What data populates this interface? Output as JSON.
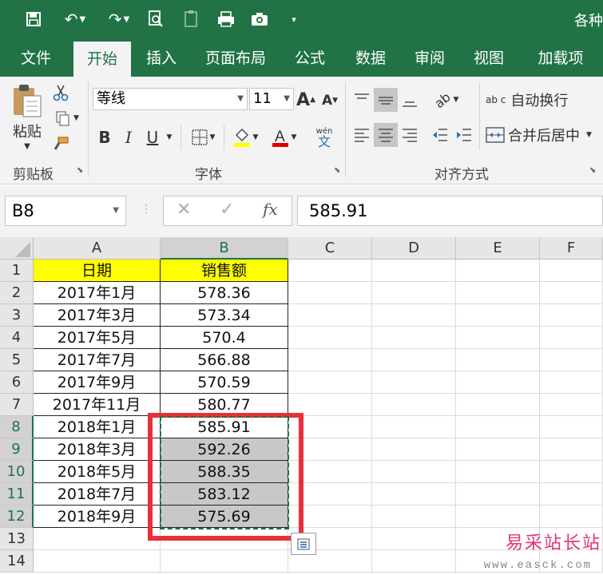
{
  "window": {
    "title_partial": "各种"
  },
  "tabs": [
    {
      "label": "文件",
      "active": false
    },
    {
      "label": "开始",
      "active": true
    },
    {
      "label": "插入",
      "active": false
    },
    {
      "label": "页面布局",
      "active": false
    },
    {
      "label": "公式",
      "active": false
    },
    {
      "label": "数据",
      "active": false
    },
    {
      "label": "审阅",
      "active": false
    },
    {
      "label": "视图",
      "active": false
    },
    {
      "label": "加载项",
      "active": false
    }
  ],
  "ribbon": {
    "clipboard": {
      "paste_label": "粘贴",
      "group_label": "剪贴板"
    },
    "font": {
      "font_name": "等线",
      "font_size": "11",
      "group_label": "字体",
      "phonetic_label": "wén",
      "phonetic_char": "文",
      "bold": "B",
      "italic": "I",
      "underline": "U",
      "grow": "A",
      "shrink": "A"
    },
    "alignment": {
      "wrap_label": "自动换行",
      "merge_label": "合并后居中",
      "group_label": "对齐方式",
      "wrap_icon_text": "ab c"
    }
  },
  "formula_bar": {
    "name_box": "B8",
    "formula": "585.91",
    "fx": "fx"
  },
  "sheet": {
    "columns": [
      "A",
      "B",
      "C",
      "D",
      "E",
      "F"
    ],
    "rows": [
      {
        "n": "1",
        "a": "日期",
        "b": "销售额"
      },
      {
        "n": "2",
        "a": "2017年1月",
        "b": "578.36"
      },
      {
        "n": "3",
        "a": "2017年3月",
        "b": "573.34"
      },
      {
        "n": "4",
        "a": "2017年5月",
        "b": "570.4"
      },
      {
        "n": "5",
        "a": "2017年7月",
        "b": "566.88"
      },
      {
        "n": "6",
        "a": "2017年9月",
        "b": "570.59"
      },
      {
        "n": "7",
        "a": "2017年11月",
        "b": "580.77"
      },
      {
        "n": "8",
        "a": "2018年1月",
        "b": "585.91"
      },
      {
        "n": "9",
        "a": "2018年3月",
        "b": "592.26"
      },
      {
        "n": "10",
        "a": "2018年5月",
        "b": "588.35"
      },
      {
        "n": "11",
        "a": "2018年7月",
        "b": "583.12"
      },
      {
        "n": "12",
        "a": "2018年9月",
        "b": "575.69"
      },
      {
        "n": "13",
        "a": "",
        "b": ""
      },
      {
        "n": "14",
        "a": "",
        "b": ""
      }
    ],
    "selection": "B8:B12",
    "header_fill": "#ffff00",
    "selection_fill": "#c8c8c8",
    "accent": "#217346",
    "highlight_border": "#e8303a"
  },
  "watermark": {
    "line1": "易采站长站",
    "line2": "www.easck.com"
  }
}
